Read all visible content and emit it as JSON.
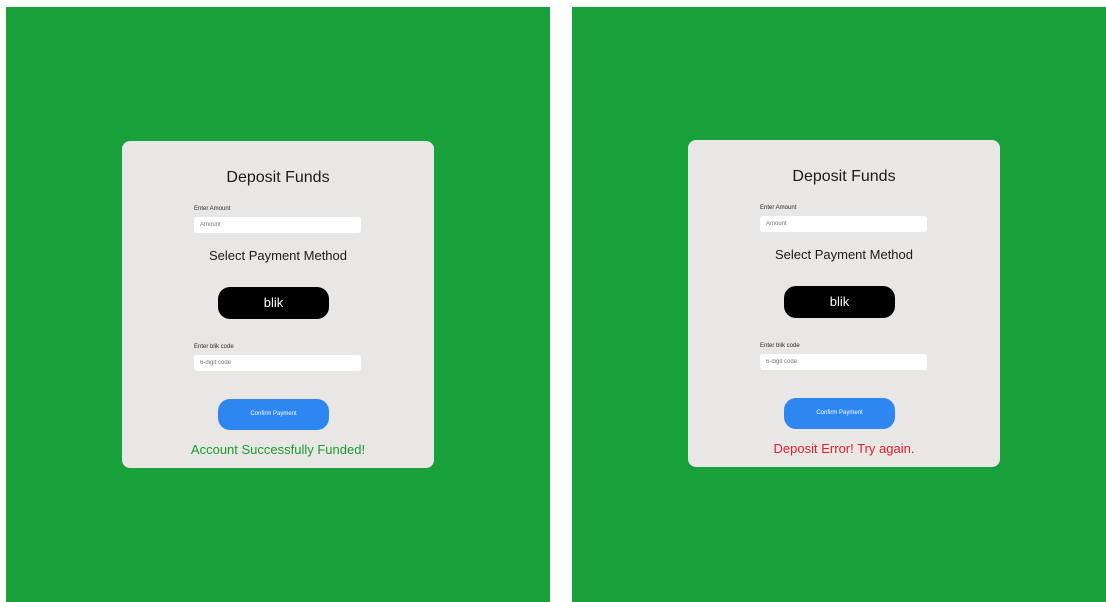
{
  "colors": {
    "background": "#18a03b",
    "card": "#e9e7e6",
    "blik_button": "#000000",
    "confirm_button": "#2e86f0",
    "success_text": "#1a9a2e",
    "error_text": "#e11d2a"
  },
  "screens": [
    {
      "title": "Deposit Funds",
      "amount_label": "Enter Amount",
      "amount_placeholder": "Amount",
      "payment_method_title": "Select Payment Method",
      "blik_button_label": "blik",
      "blik_code_label": "Enter blik code",
      "blik_code_placeholder": "6-digit code",
      "confirm_button_label": "Confirm Payment",
      "status_message": "Account Successfully Funded!"
    },
    {
      "title": "Deposit Funds",
      "amount_label": "Enter Amount",
      "amount_placeholder": "Amount",
      "payment_method_title": "Select Payment Method",
      "blik_button_label": "blik",
      "blik_code_label": "Enter blik code",
      "blik_code_placeholder": "6-digit code",
      "confirm_button_label": "Confirm Payment",
      "status_message": "Deposit Error! Try again."
    }
  ]
}
